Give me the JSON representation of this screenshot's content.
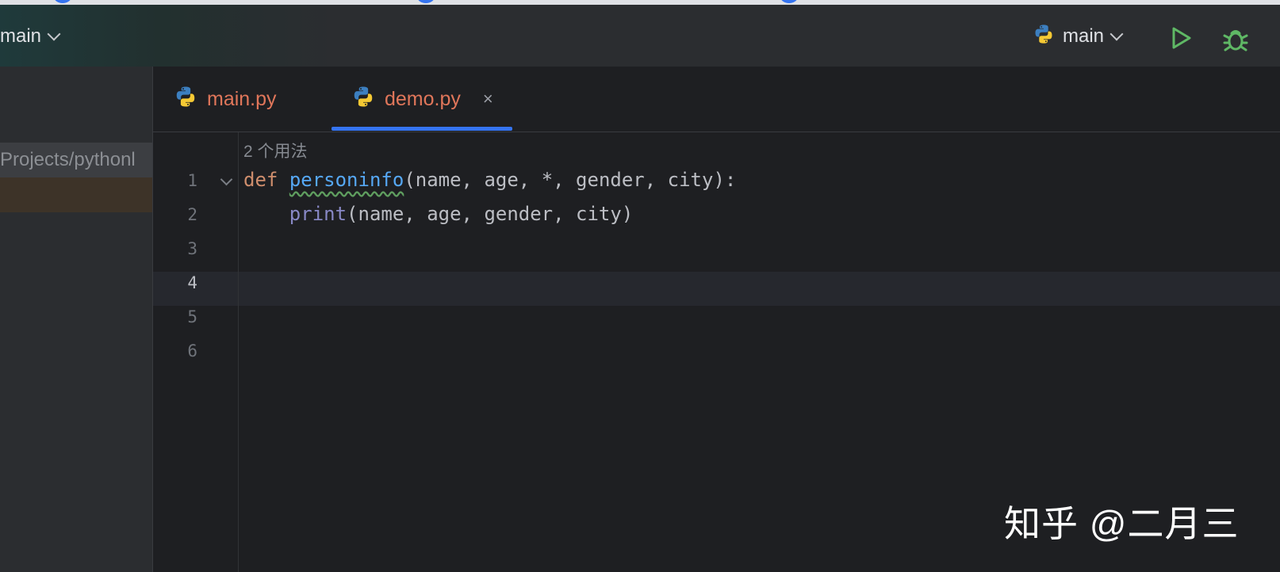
{
  "toolbar": {
    "branch_label": "main",
    "run_config_label": "main"
  },
  "project_pane": {
    "path_label": "Projects/pythonl"
  },
  "tabs": [
    {
      "label": "main.py",
      "active": false
    },
    {
      "label": "demo.py",
      "active": true,
      "close_glyph": "×"
    }
  ],
  "editor": {
    "usages_hint": "2 个用法",
    "line_numbers": [
      "1",
      "2",
      "3",
      "4",
      "5",
      "6"
    ],
    "current_line": "4",
    "lines": [
      {
        "keyword": "def",
        "function": "personinfo",
        "rest": "(name, age, *, gender, city):"
      },
      {
        "indent": "    ",
        "builtin": "print",
        "rest": "(name, age, gender, city)"
      }
    ]
  },
  "watermark": "知乎 @二月三",
  "colors": {
    "accent": "#3574f0",
    "keyword": "#cf8e6d",
    "function": "#56a8f5",
    "builtin": "#8888c6",
    "tab_text": "#e0765a",
    "run_green": "#5fb865"
  },
  "icons": [
    "python-icon",
    "chevron-down-icon",
    "run-icon",
    "debug-icon",
    "close-icon",
    "fold-icon"
  ]
}
